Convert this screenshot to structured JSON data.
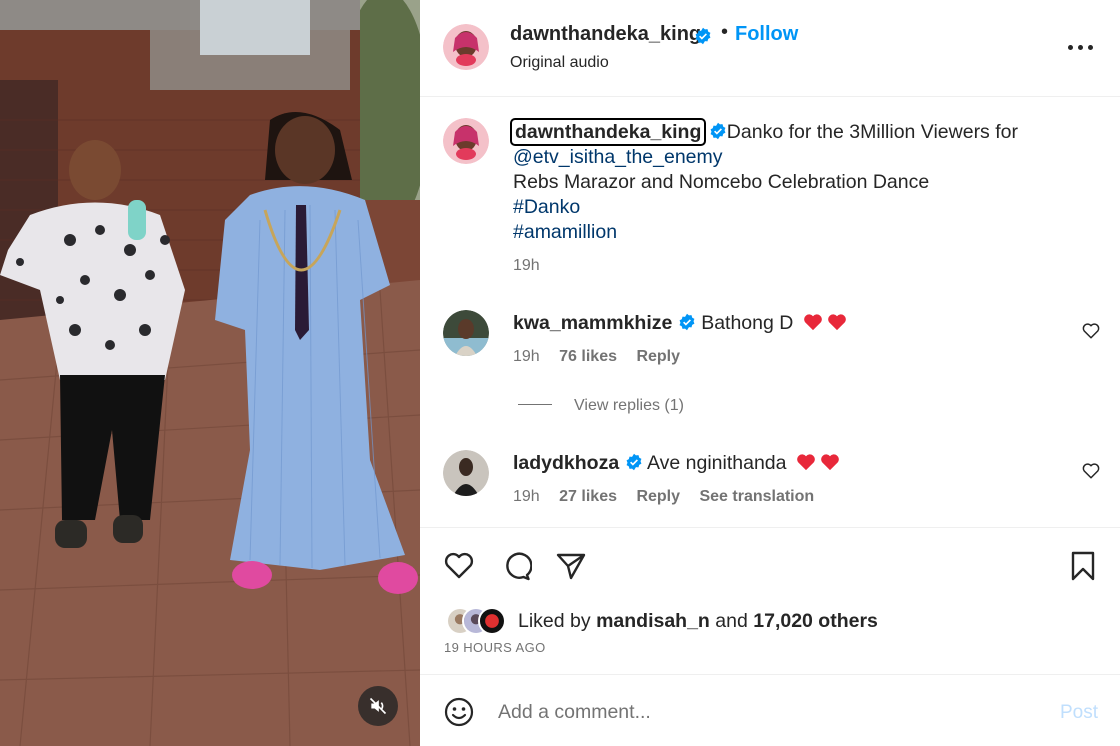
{
  "header": {
    "username": "dawnthandeka_king",
    "separator": "•",
    "follow_label": "Follow",
    "audio": "Original audio",
    "more_icon": "more-horizontal-icon"
  },
  "caption": {
    "username": "dawnthandeka_king",
    "text": "Danko for the 3Million Viewers for",
    "mention": "@etv_isitha_the_enemy",
    "line2": "Rebs Marazor and Nomcebo Celebration Dance",
    "hashtag1": "#Danko",
    "hashtag2": "#amamillion",
    "time": "19h"
  },
  "comments": [
    {
      "username": "kwa_mammkhize",
      "text": "Bathong D",
      "emoji": "❤️ ❤️",
      "time": "19h",
      "likes": "76 likes",
      "reply": "Reply",
      "replies_label": "View replies (1)"
    },
    {
      "username": "ladydkhoza",
      "text": "Ave nginithanda",
      "emoji": "❤️ ❤️",
      "time": "19h",
      "likes": "27 likes",
      "reply": "Reply",
      "translate": "See translation"
    }
  ],
  "likes": {
    "prefix": "Liked by",
    "user": "mandisah_n",
    "middle": "and",
    "others": "17,020 others"
  },
  "post_time": "19 HOURS AGO",
  "comment_box": {
    "placeholder": "Add a comment...",
    "post_label": "Post"
  },
  "colors": {
    "accent": "#0095f6",
    "verified": "#0095f6",
    "heart": "#ed4956",
    "muted": "#737373"
  }
}
